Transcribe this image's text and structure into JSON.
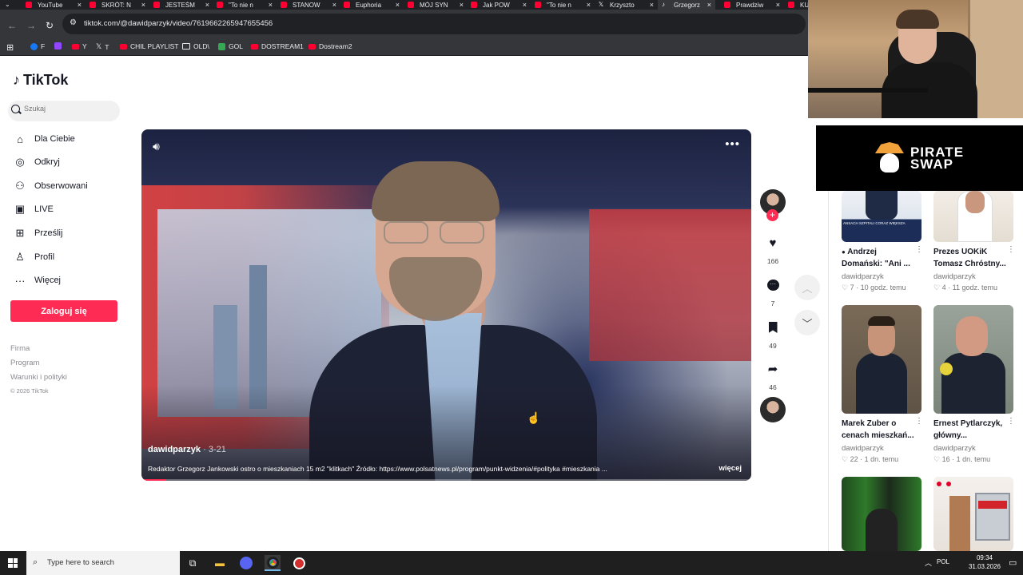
{
  "browser": {
    "tabs": [
      {
        "title": "YouTube",
        "icon": "youtube-icon",
        "active": false
      },
      {
        "title": "SKRÓT: N",
        "icon": "youtube-icon",
        "active": false
      },
      {
        "title": "JESTEŚM",
        "icon": "youtube-icon",
        "active": false
      },
      {
        "title": "\"To nie n",
        "icon": "youtube-icon",
        "active": false
      },
      {
        "title": "STANOW",
        "icon": "youtube-icon",
        "active": false
      },
      {
        "title": "Euphoria",
        "icon": "youtube-icon",
        "active": false
      },
      {
        "title": "MÓJ SYN",
        "icon": "youtube-icon",
        "active": false
      },
      {
        "title": "Jak POW",
        "icon": "youtube-icon",
        "active": false
      },
      {
        "title": "\"To nie n",
        "icon": "youtube-icon",
        "active": false
      },
      {
        "title": "Krzyszto",
        "icon": "x-icon",
        "active": false
      },
      {
        "title": "Grzegorz",
        "icon": "tiktok-icon",
        "active": true
      },
      {
        "title": "Prawdziw",
        "icon": "youtube-icon",
        "active": false
      },
      {
        "title": "KU",
        "icon": "youtube-icon",
        "active": false
      }
    ],
    "url": "tiktok.com/@dawidparzyk/video/7619662265947655456",
    "bookmarks": [
      {
        "label": "F",
        "icon": "facebook-icon"
      },
      {
        "label": "",
        "icon": "twitch-icon"
      },
      {
        "label": "Y",
        "icon": "youtube-icon"
      },
      {
        "label": "T",
        "icon": "x-icon"
      },
      {
        "label": "CHIL PLAYLIST",
        "icon": "youtube-icon"
      },
      {
        "label": "OLD\\",
        "icon": "folder-icon"
      },
      {
        "label": "GOL",
        "icon": "gol-icon"
      },
      {
        "label": "DOSTREAM1",
        "icon": "youtube-icon"
      },
      {
        "label": "Dostream2",
        "icon": "youtube-icon"
      }
    ]
  },
  "tiktok": {
    "logo_text": "TikTok",
    "search_placeholder": "Szukaj",
    "nav": [
      {
        "label": "Dla Ciebie",
        "icon": "home-icon"
      },
      {
        "label": "Odkryj",
        "icon": "compass-icon"
      },
      {
        "label": "Obserwowani",
        "icon": "following-icon"
      },
      {
        "label": "LIVE",
        "icon": "live-icon"
      },
      {
        "label": "Prześlij",
        "icon": "upload-icon"
      },
      {
        "label": "Profil",
        "icon": "profile-icon"
      },
      {
        "label": "Więcej",
        "icon": "more-icon"
      }
    ],
    "login_label": "Zaloguj się",
    "footer_links": [
      "Firma",
      "Program",
      "Warunki i polityki"
    ],
    "copyright": "© 2026 TikTok",
    "video": {
      "author": "dawidparzyk",
      "date": "3-21",
      "description": "Redaktor Grzegorz Jankowski ostro o mieszkaniach 15 m2 \"klitkach\" Źródło: https://www.polsatnews.pl/program/punkt-widzenia/#polityka #mieszkania ...",
      "more_label": "więcej",
      "progress_percent": 4
    },
    "actions": {
      "likes": "166",
      "comments": "7",
      "saves": "49",
      "shares": "46"
    },
    "recommended": [
      {
        "title": "Andrzej Domański: \"Ani ...",
        "author": "dawidparzyk",
        "likes": "7",
        "time": "10 godz. temu",
        "thumb_caption": "ANSACH SZPITALI CORAZ WIĘKSZA"
      },
      {
        "title": "Prezes UOKiK Tomasz Chróstny...",
        "author": "dawidparzyk",
        "likes": "4",
        "time": "11 godz. temu",
        "thumb_caption": ""
      },
      {
        "title": "Marek Zuber o cenach mieszkań...",
        "author": "dawidparzyk",
        "likes": "22",
        "time": "1 dn. temu",
        "thumb_caption": ""
      },
      {
        "title": "Ernest Pytlarczyk, główny...",
        "author": "dawidparzyk",
        "likes": "16",
        "time": "1 dn. temu",
        "thumb_caption": ""
      }
    ]
  },
  "overlay": {
    "sponsor_line1": "PIRATE",
    "sponsor_line2": "SWAP"
  },
  "taskbar": {
    "search_placeholder": "Type here to search",
    "language": "POL",
    "time": "09:34",
    "date": "31.03.2026"
  },
  "colors": {
    "tiktok_accent": "#fe2c55",
    "chrome_dark": "#202124",
    "chrome_toolbar": "#35363a"
  }
}
